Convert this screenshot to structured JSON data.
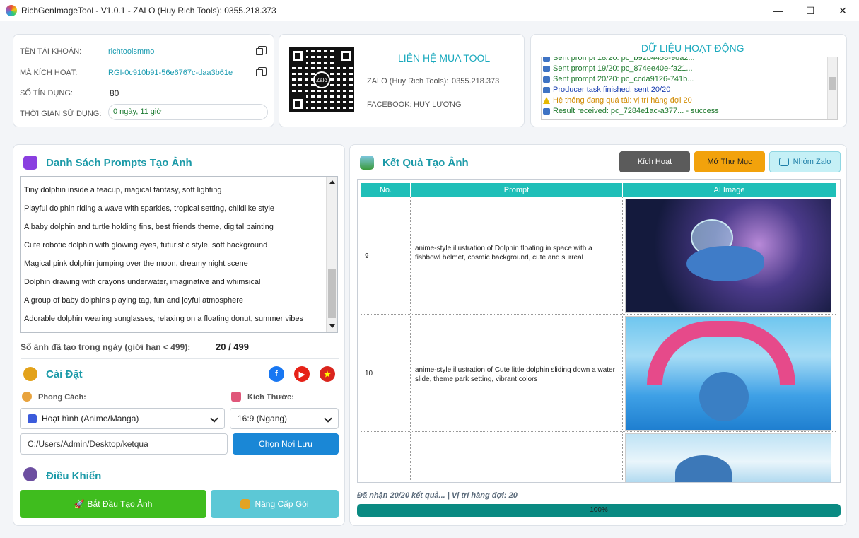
{
  "window": {
    "title": "RichGenImageTool  -  V1.0.1  -  ZALO (Huy Rich Tools):   0355.218.373",
    "minimize": "—",
    "maximize": "☐",
    "close": "✕"
  },
  "account": {
    "username_label": "TÊN TÀI KHOẢN:",
    "username": "richtoolsmmo",
    "key_label": "MÃ KÍCH HOẠT:",
    "key": "RGI-0c910b91-56e6767c-daa3b61e",
    "credits_label": "SỐ TÍN DỤNG:",
    "credits": "80",
    "usage_label": "THỜI GIAN SỬ DỤNG:",
    "usage": "0 ngày, 11 giờ"
  },
  "contact": {
    "title": "LIÊN HỆ MUA TOOL",
    "zalo_label": "ZALO (Huy Rich Tools):",
    "zalo_value": "0355.218.373",
    "facebook_label": "FACEBOOK:",
    "facebook_value": "HUY LƯƠNG",
    "qr_logo": "Zalo"
  },
  "activity": {
    "title": "DỮ LIỆU HOẠT ĐỘNG",
    "lines": [
      {
        "text": "Sent prompt 18/20: pc_b92b4458-9da2...",
        "color": "#1f7a2e",
        "icon": "upload-icon"
      },
      {
        "text": "Sent prompt 19/20: pc_874ee40e-fa21...",
        "color": "#1f7a2e",
        "icon": "upload-icon"
      },
      {
        "text": "Sent prompt 20/20: pc_ccda9126-741b...",
        "color": "#1f7a2e",
        "icon": "upload-icon"
      },
      {
        "text": "Producer task finished: sent 20/20",
        "color": "#1a3fb0",
        "icon": "info-icon"
      },
      {
        "text": "Hệ thống đang quá tải: vị trí hàng đợi 20",
        "color": "#d08a00",
        "icon": "warning-icon"
      },
      {
        "text": "Result received: pc_7284e1ac-a377... - success",
        "color": "#1f7a2e",
        "icon": "download-icon"
      }
    ]
  },
  "prompts": {
    "title": "Danh Sách Prompts Tạo Ảnh",
    "items": [
      "Tiny dolphin inside a teacup, magical fantasy, soft lighting",
      "Playful dolphin riding a wave with sparkles, tropical setting, childlike style",
      "A baby dolphin and turtle holding fins, best friends theme, digital painting",
      "Cute robotic dolphin with glowing eyes, futuristic style, soft background",
      "Magical pink dolphin jumping over the moon, dreamy night scene",
      "Dolphin drawing with crayons underwater, imaginative and whimsical",
      "A group of baby dolphins playing tag, fun and joyful atmosphere",
      "Adorable dolphin wearing sunglasses, relaxing on a floating donut, summer vibes"
    ],
    "daily_label": "Số ảnh đã tạo trong ngày (giới hạn < 499):",
    "daily_value": "20 / 499"
  },
  "settings": {
    "title": "Cài Đặt",
    "style_label": "Phong Cách:",
    "style_value": "Hoạt hình (Anime/Manga)",
    "size_label": "Kích Thước:",
    "size_value": "16:9 (Ngang)",
    "path_value": "C:/Users/Admin/Desktop/ketqua",
    "choose_button": "Chọn Nơi Lưu"
  },
  "control": {
    "title": "Điều Khiển",
    "start_button": "Bắt Đầu Tạo Ảnh",
    "upgrade_button": "Nâng Cấp Gói"
  },
  "results": {
    "title": "Kết Quả Tạo Ảnh",
    "activate_button": "Kích Hoạt",
    "open_folder_button": "Mở Thư Mục",
    "zalo_group_button": "Nhóm Zalo",
    "columns": [
      "No.",
      "Prompt",
      "AI Image"
    ],
    "rows": [
      {
        "no": "9",
        "prompt": "anime-style illustration of Dolphin floating in space with a fishbowl helmet, cosmic background, cute and surreal"
      },
      {
        "no": "10",
        "prompt": "anime-style illustration of Cute little dolphin sliding down a water slide, theme park setting, vibrant colors"
      },
      {
        "no": "",
        "prompt": ""
      }
    ],
    "status": "Đã nhận 20/20 kết quả... | Vị trí hàng đợi: 20",
    "progress_percent": 100,
    "progress_label": "100%"
  }
}
